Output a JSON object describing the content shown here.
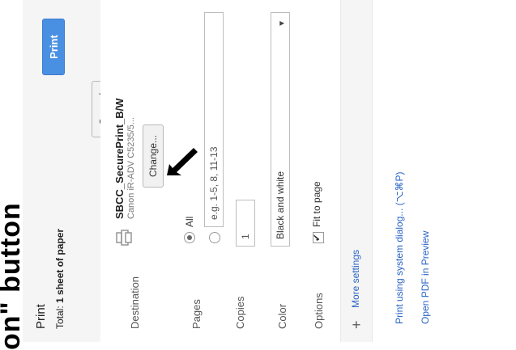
{
  "overlay": {
    "text": "on\" button"
  },
  "dialog": {
    "title": "Print",
    "total_prefix": "Total: ",
    "total_value": "1 sheet of paper",
    "buttons": {
      "print": "Print",
      "cancel": "Cancel"
    }
  },
  "destination": {
    "label": "Destination",
    "printer_name": "SBCC_SecurePrint_B/W",
    "printer_model": "Canon iR-ADV C5235/5...",
    "change_label": "Change..."
  },
  "pages": {
    "label": "Pages",
    "all_label": "All",
    "custom_placeholder": "e.g. 1-5, 8, 11-13",
    "selected": "All"
  },
  "copies": {
    "label": "Copies",
    "value": "1"
  },
  "color": {
    "label": "Color",
    "value": "Black and white"
  },
  "options": {
    "label": "Options",
    "fit_to_page_label": "Fit to page",
    "fit_to_page_checked": true
  },
  "more_settings": {
    "label": "More settings"
  },
  "links": {
    "system_dialog": "Print using system dialog... (⌥⌘P)",
    "open_pdf": "Open PDF in Preview"
  },
  "colors": {
    "accent": "#4a90e2",
    "link": "#2a64c5",
    "header_bg": "#f5f5f5"
  }
}
